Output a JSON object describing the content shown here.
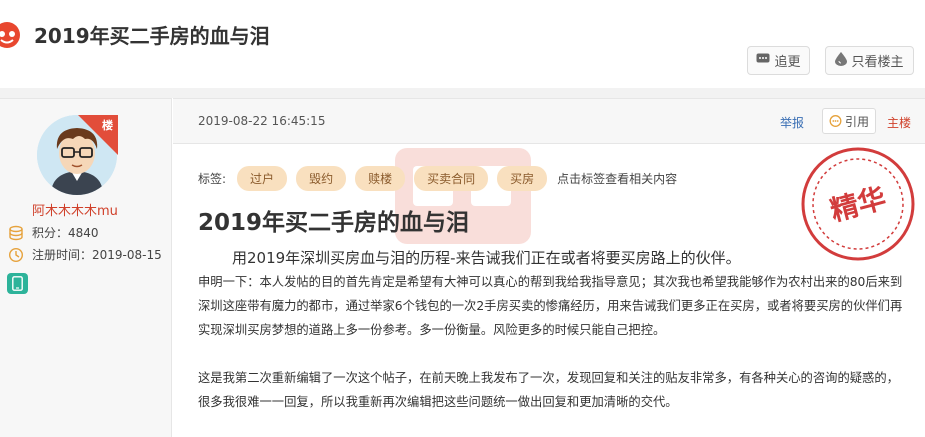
{
  "header": {
    "title": "2019年买二手房的血与泪",
    "btn_reverse": "追更",
    "btn_owner_only": "只看楼主"
  },
  "author": {
    "badge": "楼",
    "name": "阿木木木木mu",
    "points_label": "积分：",
    "points": "4840",
    "reg_label": "注册时间：",
    "reg_date": "2019-08-15"
  },
  "postbar": {
    "datetime": "2019-08-22 16:45:15",
    "report": "举报",
    "quote": "引用",
    "floor": "主楼"
  },
  "post": {
    "tags_label": "标签:",
    "tags": [
      "过户",
      "毁约",
      "赎楼",
      "买卖合同",
      "买房"
    ],
    "tags_hint": "点击标签查看相关内容",
    "seal_text": "精华",
    "title": "2019年买二手房的血与泪",
    "lead": "用2019年深圳买房血与泪的历程-来告诫我们正在或者将要买房路上的伙伴。",
    "para1": "申明一下：本人发帖的目的首先肯定是希望有大神可以真心的帮到我给我指导意见；其次我也希望我能够作为农村出来的80后来到深圳这座带有魔力的都市，通过举家6个钱包的一次2手房买卖的惨痛经历，用来告诫我们更多正在买房，或者将要买房的伙伴们再实现深圳买房梦想的道路上多一份参考。多一份衡量。风险更多的时候只能自己把控。",
    "para2": "这是我第二次重新编辑了一次这个帖子，在前天晚上我发布了一次，发现回复和关注的贴友非常多，有各种关心的咨询的疑惑的，很多我很难一一回复，所以我重新再次编辑把这些问题统一做出回复和更加清晰的交代。"
  },
  "colors": {
    "accent_red": "#d0402a",
    "tag_bg": "#f9e0bf",
    "link_blue": "#3a6fb4",
    "seal_red": "#d23c3c"
  }
}
